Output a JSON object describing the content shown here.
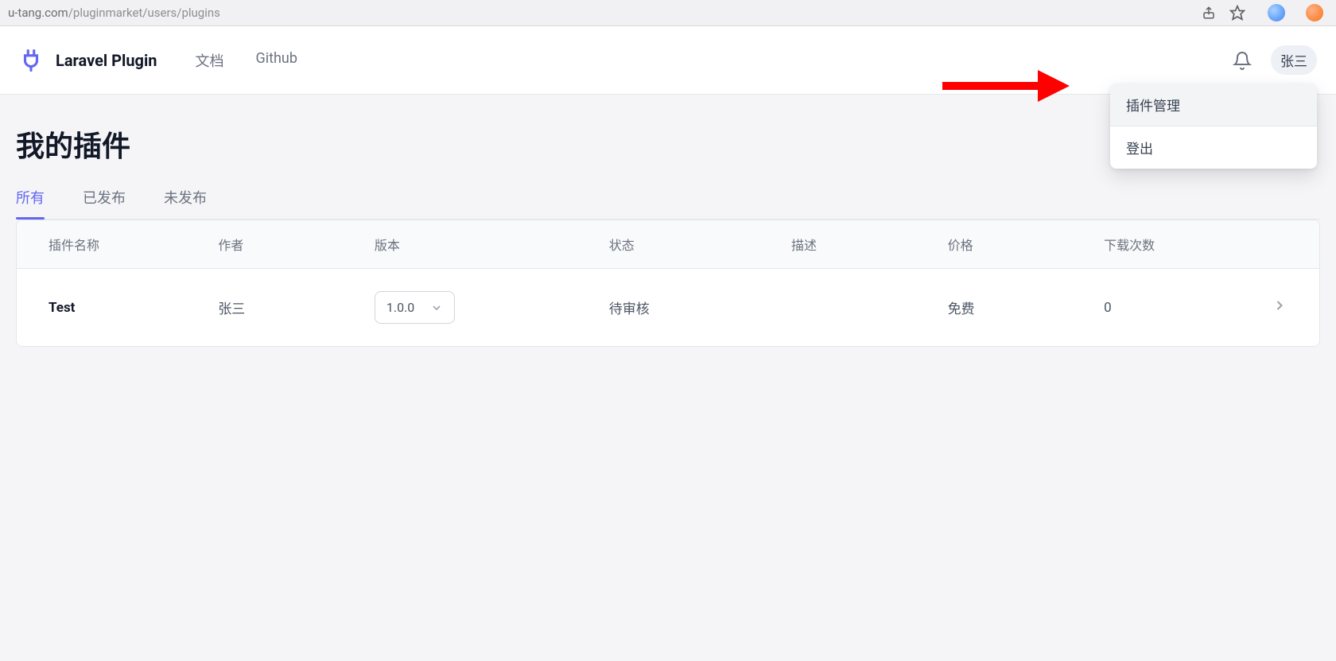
{
  "browser": {
    "url_host": "u-tang.com",
    "url_path": "/pluginmarket/users/plugins"
  },
  "header": {
    "brand": "Laravel Plugin",
    "nav": {
      "docs": "文档",
      "github": "Github"
    },
    "user_name": "张三"
  },
  "dropdown": {
    "plugin_manage": "插件管理",
    "logout": "登出"
  },
  "page": {
    "title": "我的插件"
  },
  "tabs": {
    "all": "所有",
    "published": "已发布",
    "unpublished": "未发布"
  },
  "table": {
    "headers": {
      "name": "插件名称",
      "author": "作者",
      "version": "版本",
      "status": "状态",
      "description": "描述",
      "price": "价格",
      "downloads": "下载次数"
    },
    "rows": [
      {
        "name": "Test",
        "author": "张三",
        "version": "1.0.0",
        "status": "待审核",
        "description": "",
        "price": "免费",
        "downloads": "0"
      }
    ]
  }
}
